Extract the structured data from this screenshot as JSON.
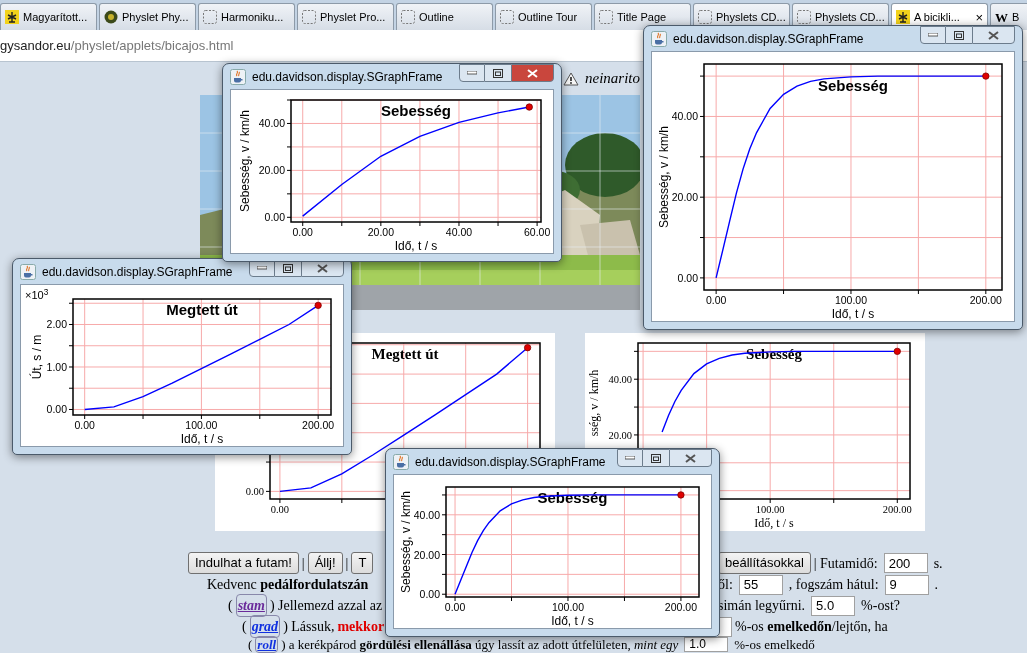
{
  "tabs": [
    {
      "label": "Magyarított...",
      "kind": "emblem",
      "selected": false
    },
    {
      "label": "Physlet Phy...",
      "kind": "globe",
      "selected": false
    },
    {
      "label": "Harmoniku...",
      "kind": "blank",
      "selected": false
    },
    {
      "label": "Physlet Pro...",
      "kind": "blank",
      "selected": false
    },
    {
      "label": "Outline",
      "kind": "blank",
      "selected": false
    },
    {
      "label": "Outline Tour",
      "kind": "blank",
      "selected": false
    },
    {
      "label": "Title Page",
      "kind": "blank",
      "selected": false
    },
    {
      "label": "Physlets CD...",
      "kind": "blank",
      "selected": false
    },
    {
      "label": "Physlets CD...",
      "kind": "blank",
      "selected": false
    },
    {
      "label": "A bicikli...",
      "kind": "emblem",
      "selected": true,
      "close_glyph": "×"
    },
    {
      "label": "B",
      "kind": "letter",
      "favicon": "W",
      "selected": false
    }
  ],
  "address": {
    "host": "gysandor.eu",
    "path": "/physlet/applets/bicajos.html"
  },
  "page": {
    "top_text": "neinarito",
    "charts": [
      {
        "title": "Megtett út",
        "tick_labels": [
          "0.00",
          "0.00"
        ]
      },
      {
        "chart_data": {
          "type": "line",
          "grid": true,
          "title": "Sebesség",
          "xlabel": "Idő, t / s",
          "ylabel": "sség, v / km/h",
          "x": [
            15,
            20,
            25,
            30,
            40,
            50,
            60,
            70,
            80,
            100,
            120,
            150,
            200
          ],
          "series": [
            {
              "color": "#0000ff",
              "values": [
                21,
                27,
                32,
                36,
                42,
                45.5,
                47.5,
                48.7,
                49.3,
                49.8,
                50,
                50,
                50
              ]
            }
          ],
          "xlim": [
            -4,
            210
          ],
          "ylim": [
            -3,
            53
          ],
          "xticks": [
            {
              "value": 100,
              "label": "100.00"
            },
            {
              "value": 200,
              "label": "200.00"
            }
          ],
          "yticks": [
            {
              "value": 20,
              "label": "20.00"
            },
            {
              "value": 40,
              "label": "40.00"
            }
          ]
        }
      }
    ],
    "rows": [
      {
        "left": [
          {
            "kind": "button",
            "text": "Indulhat a futam!"
          },
          {
            "kind": "text",
            "text": "|"
          },
          {
            "kind": "button",
            "text": "Állj!"
          },
          {
            "kind": "text",
            "text": "|"
          },
          {
            "kind": "button",
            "text": "T"
          }
        ],
        "right": [
          {
            "kind": "button",
            "text": "beállításokkal"
          },
          {
            "kind": "text",
            "text": "| Futamidő:"
          },
          {
            "kind": "input",
            "value": "200"
          },
          {
            "kind": "text",
            "text": "s."
          }
        ]
      },
      {
        "left": [
          {
            "kind": "text",
            "text": "Kedvenc **pedálfordulatszán**"
          }
        ],
        "right": [
          {
            "kind": "text",
            "text": "ől:"
          },
          {
            "kind": "input",
            "value": "55"
          },
          {
            "kind": "text",
            "text": ", fogszám hátul:"
          },
          {
            "kind": "input",
            "value": "9"
          },
          {
            "kind": "text",
            "text": "."
          }
        ]
      },
      {
        "left": [
          {
            "kind": "text",
            "text": "("
          },
          {
            "kind": "link",
            "text": "stam",
            "visited": true
          },
          {
            "kind": "text",
            "text": ") Jellemezd azzal az"
          }
        ],
        "right": [
          {
            "kind": "text",
            "text": "simán legyűrni."
          },
          {
            "kind": "input",
            "value": "5.0"
          },
          {
            "kind": "text",
            "text": "%-ost?"
          }
        ]
      },
      {
        "left": [
          {
            "kind": "text",
            "text": "("
          },
          {
            "kind": "link",
            "text": "grad",
            "visited": false
          },
          {
            "kind": "text",
            "text": ") Lássuk,"
          },
          {
            "kind": "hot",
            "text": "mekkor"
          }
        ],
        "right": [
          {
            "kind": "input_edge"
          },
          {
            "kind": "text",
            "text": "%-os **emelkedőn**/lejtőn, ha"
          }
        ]
      },
      {
        "left": [
          {
            "kind": "text",
            "text": "("
          },
          {
            "kind": "link",
            "text": "roll",
            "visited": false
          },
          {
            "kind": "text",
            "text": ") a kerékpárod **gördülési ellenállása** úgy lassít az adott útfelületen, *mint egy*"
          },
          {
            "kind": "input",
            "value": "1.0"
          },
          {
            "kind": "text",
            "text": "%-os emelkedő"
          }
        ]
      }
    ]
  },
  "windows": [
    {
      "title": "edu.davidson.display.SGraphFrame",
      "active": true,
      "chart_data": {
        "type": "line",
        "grid": true,
        "title": "Sebesség",
        "xlabel": "Idő, t / s",
        "ylabel": "Sebesség, v / km/h",
        "x": [
          0,
          10,
          20,
          30,
          40,
          50,
          58
        ],
        "series": [
          {
            "color": "#0000ff",
            "values": [
              0.5,
              14,
              26,
              34.5,
              40.5,
              44.5,
              47
            ]
          }
        ],
        "xlim": [
          -3,
          61
        ],
        "ylim": [
          -2,
          50
        ],
        "xticks": [
          {
            "value": 0,
            "label": "0.00"
          },
          {
            "value": 20,
            "label": "20.00"
          },
          {
            "value": 40,
            "label": "40.00"
          },
          {
            "value": 60,
            "label": "60.00"
          }
        ],
        "yticks": [
          {
            "value": 0,
            "label": "0.00"
          },
          {
            "value": 20,
            "label": "20.00"
          },
          {
            "value": 40,
            "label": "40.00"
          }
        ]
      }
    },
    {
      "title": "edu.davidson.display.SGraphFrame",
      "active": false,
      "chart_data": {
        "type": "line",
        "grid": true,
        "title": "Sebesség",
        "xlabel": "Idő, t / s",
        "ylabel": "Sebesség, v / km/h",
        "x": [
          0,
          5,
          10,
          15,
          20,
          25,
          30,
          40,
          50,
          60,
          70,
          80,
          100,
          120,
          150,
          200
        ],
        "series": [
          {
            "color": "#0000ff",
            "values": [
              0,
              7,
              14,
              21,
              27,
              32,
              36,
              42,
              45.5,
              47.5,
              48.7,
              49.3,
              49.8,
              50,
              50,
              50
            ]
          }
        ],
        "xlim": [
          -9,
          212
        ],
        "ylim": [
          -3,
          53
        ],
        "xticks": [
          {
            "value": 0,
            "label": "0.00"
          },
          {
            "value": 100,
            "label": "100.00"
          },
          {
            "value": 200,
            "label": "200.00"
          }
        ],
        "yticks": [
          {
            "value": 0,
            "label": "0.00"
          },
          {
            "value": 20,
            "label": "20.00"
          },
          {
            "value": 40,
            "label": "40.00"
          }
        ]
      }
    },
    {
      "title": "edu.davidson.display.SGraphFrame",
      "active": false,
      "y_multiplier": "×10$^{3}$",
      "chart_data": {
        "type": "line",
        "grid": true,
        "title": "Megtett út",
        "xlabel": "Idő, t / s",
        "ylabel": "Út, s / m",
        "x": [
          0,
          25,
          50,
          75,
          100,
          125,
          150,
          175,
          200
        ],
        "series": [
          {
            "color": "#0000ff",
            "values": [
              0,
              0.06,
              0.3,
              0.62,
              0.96,
              1.3,
              1.65,
              2.0,
              2.45
            ]
          }
        ],
        "xlim": [
          -10,
          211
        ],
        "ylim": [
          -0.13,
          2.6
        ],
        "xticks": [
          {
            "value": 0,
            "label": "0.00"
          },
          {
            "value": 100,
            "label": "100.00"
          },
          {
            "value": 200,
            "label": "200.00"
          }
        ],
        "yticks": [
          {
            "value": 0,
            "label": "0.00"
          },
          {
            "value": 1,
            "label": "1.00"
          },
          {
            "value": 2,
            "label": "2.00"
          }
        ]
      }
    },
    {
      "title": "edu.davidson.display.SGraphFrame",
      "active": false,
      "chart_data": {
        "type": "line",
        "grid": true,
        "title": "Sebesség",
        "xlabel": "Idő, t / s",
        "ylabel": "Sebesség, v / km/h",
        "x": [
          0,
          5,
          10,
          15,
          20,
          25,
          30,
          40,
          50,
          60,
          70,
          80,
          100,
          120,
          150,
          200
        ],
        "series": [
          {
            "color": "#0000ff",
            "values": [
              0,
              7,
              14,
              21,
              27,
              32,
              36,
              42,
              45.5,
              47.5,
              48.7,
              49.3,
              49.8,
              50,
              50,
              50
            ]
          }
        ],
        "xlim": [
          -8,
          216
        ],
        "ylim": [
          -1.4,
          54
        ],
        "xticks": [
          {
            "value": 0,
            "label": "0.00"
          },
          {
            "value": 100,
            "label": "100.00"
          },
          {
            "value": 200,
            "label": "200.00"
          }
        ],
        "yticks": [
          {
            "value": 0,
            "label": "0.00"
          },
          {
            "value": 20,
            "label": "20.00"
          },
          {
            "value": 40,
            "label": "40.00"
          }
        ]
      }
    }
  ]
}
